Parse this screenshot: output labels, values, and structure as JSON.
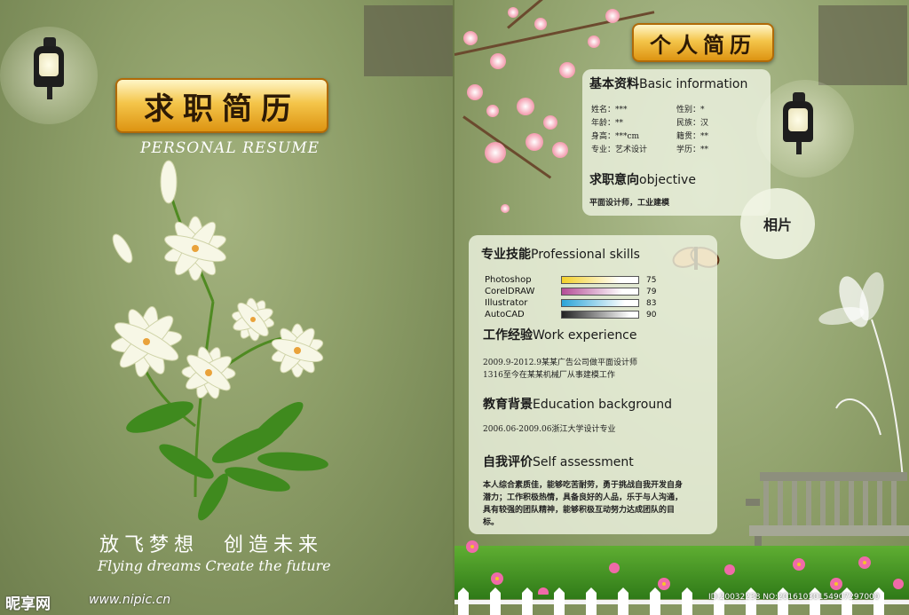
{
  "left": {
    "title": "求职简历",
    "subtitle": "PERSONAL RESUME",
    "slogan_cn": "放飞梦想　创造未来",
    "slogan_en": "Flying dreams Create the future"
  },
  "watermark": {
    "logo": "昵享网",
    "url": "www.nipic.cn",
    "id": "ID:20032238 NO:20161030154907297000"
  },
  "right": {
    "title": "个人简历",
    "photo_label": "相片",
    "basic": {
      "head_cn": "基本资料",
      "head_en": "Basic information",
      "fields": [
        [
          "姓名：***",
          "性别：*"
        ],
        [
          "年龄：**",
          "民族：汉"
        ],
        [
          "身高：***cm",
          "籍贯：**"
        ],
        [
          "专业：艺术设计",
          "学历：**"
        ]
      ]
    },
    "objective": {
      "head_cn": "求职意向",
      "head_en": "objective",
      "text": "平面设计师，工业建模"
    },
    "skills": {
      "head_cn": "专业技能",
      "head_en": "Professional skills",
      "items": [
        {
          "name": "Photoshop",
          "value": "75",
          "pct": 75,
          "color": "#f3d02a"
        },
        {
          "name": "CorelDRAW",
          "value": "79",
          "pct": 79,
          "color": "#b44c96"
        },
        {
          "name": "Illustrator",
          "value": "83",
          "pct": 83,
          "color": "#2aa4d8"
        },
        {
          "name": "AutoCAD",
          "value": "90",
          "pct": 90,
          "color": "#222222"
        }
      ]
    },
    "work": {
      "head_cn": "工作经验",
      "head_en": "Work experience",
      "lines": [
        "2009.9-2012.9某某广告公司做平面设计师",
        "1316至今在某某机械厂从事建模工作"
      ]
    },
    "education": {
      "head_cn": "教育背景",
      "head_en": "Education background",
      "line": "2006.06-2009.06浙江大学设计专业"
    },
    "self": {
      "head_cn": "自我评价",
      "head_en": "Self assessment",
      "text": "本人综合素质佳，能够吃苦耐劳，勇于挑战自我开发自身潜力；工作积极热情，具备良好的人品，乐于与人沟通，具有较强的团队精神，能够积极互动努力达成团队的目标。"
    }
  }
}
